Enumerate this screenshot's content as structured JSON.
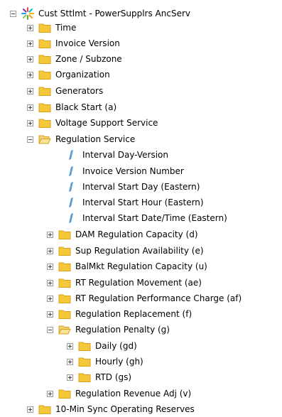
{
  "root": {
    "label": "Cust Sttlmt - PowerSupplrs AncServ",
    "icon": "sparkle-cube-icon"
  },
  "top_items": [
    {
      "label": "Time"
    },
    {
      "label": "Invoice Version"
    },
    {
      "label": "Zone / Subzone"
    },
    {
      "label": "Organization"
    },
    {
      "label": "Generators"
    },
    {
      "label": "Black Start (a)"
    },
    {
      "label": "Voltage Support Service"
    }
  ],
  "regulation": {
    "label": "Regulation Service",
    "leaves": [
      {
        "label": "Interval Day-Version"
      },
      {
        "label": "Invoice Version Number"
      },
      {
        "label": "Interval Start Day (Eastern)"
      },
      {
        "label": "Interval Start Hour (Eastern)"
      },
      {
        "label": "Interval Start Date/Time (Eastern)"
      }
    ],
    "folders": [
      {
        "label": "DAM Regulation Capacity (d)"
      },
      {
        "label": "Sup Regulation Availability (e)"
      },
      {
        "label": "BalMkt Regulation Capacity (u)"
      },
      {
        "label": "RT Regulation Movement (ae)"
      },
      {
        "label": "RT Regulation Performance Charge (af)"
      },
      {
        "label": "Regulation Replacement (f)"
      }
    ],
    "penalty": {
      "label": "Regulation Penalty (g)",
      "children": [
        {
          "label": "Daily (gd)"
        },
        {
          "label": "Hourly (gh)"
        },
        {
          "label": "RTD (gs)"
        }
      ]
    },
    "revenue_adj": {
      "label": "Regulation Revenue Adj (v)"
    }
  },
  "bottom_item": {
    "label": "10-Min Sync Operating Reserves"
  },
  "colors": {
    "folder": "#f5c83a",
    "folder_dark": "#d9a21a",
    "leaf_icon": "#5b9bd5"
  }
}
